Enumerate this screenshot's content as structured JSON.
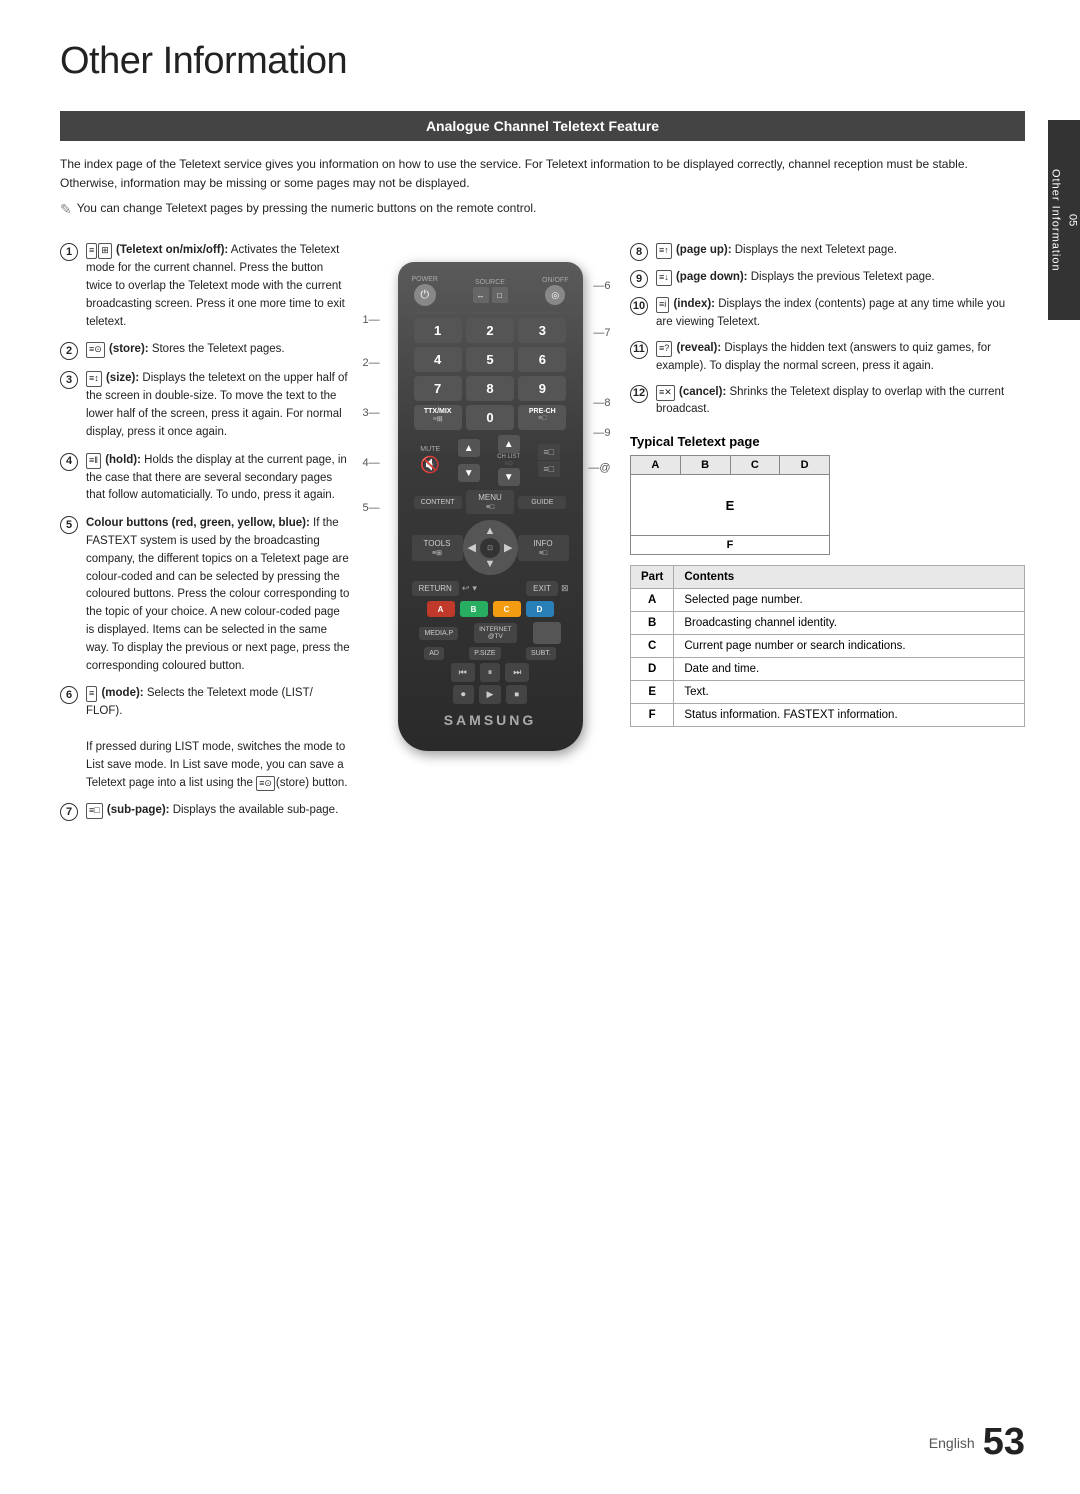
{
  "page": {
    "title": "Other Information",
    "side_tab": "Other Information",
    "side_tab_num": "05",
    "footer_english": "English",
    "footer_num": "53"
  },
  "section": {
    "header": "Analogue Channel Teletext Feature",
    "intro": "The index page of the Teletext service gives you information on how to use the service. For Teletext information to be displayed correctly, channel reception must be stable. Otherwise, information may be missing or some pages may not be displayed.",
    "note": "You can change Teletext pages by pressing the numeric buttons on the remote control."
  },
  "left_bullets": [
    {
      "num": "1",
      "text": "(Teletext on/mix/off): Activates the Teletext mode for the current channel. Press the button twice to overlap the Teletext mode with the current broadcasting screen. Press it one more time to exit teletext."
    },
    {
      "num": "2",
      "text": "(store): Stores the Teletext pages."
    },
    {
      "num": "3",
      "text": "(size): Displays the teletext on the upper half of the screen in double-size. To move the text to the lower half of the screen, press it again. For normal display, press it once again."
    },
    {
      "num": "4",
      "text": "(hold): Holds the display at the current page, in the case that there are several secondary pages that follow automaticially. To undo, press it again."
    },
    {
      "num": "5",
      "text": "Colour buttons (red, green, yellow, blue): If the FASTEXT system is used by the broadcasting company, the different topics on a Teletext page are colour-coded and can be selected by pressing the coloured buttons. Press the colour corresponding to the topic of your choice. A new colour-coded page is displayed. Items can be selected in the same way. To display the previous or next page, press the corresponding coloured button."
    },
    {
      "num": "6",
      "text": "(mode): Selects the Teletext mode (LIST/ FLOF).\n\nIf pressed during LIST mode, switches the mode to List save mode. In List save mode, you can save a Teletext page into a list using the (store) button."
    },
    {
      "num": "7",
      "text": "(sub-page): Displays the available sub-page."
    }
  ],
  "right_bullets": [
    {
      "num": "8",
      "text": "(page up): Displays the next Teletext page."
    },
    {
      "num": "9",
      "text": "(page down): Displays the previous Teletext page."
    },
    {
      "num": "10",
      "text": "(index): Displays the index (contents) page at any time while you are viewing Teletext."
    },
    {
      "num": "11",
      "text": "(reveal): Displays the hidden text (answers to quiz games, for example). To display the normal screen, press it again."
    },
    {
      "num": "12",
      "text": "(cancel): Shrinks the Teletext display to overlap with the current broadcast."
    }
  ],
  "teletext_page": {
    "title": "Typical Teletext page",
    "cells": [
      "A",
      "B",
      "C",
      "D"
    ],
    "body_label": "E",
    "footer_label": "F"
  },
  "parts_table": {
    "headers": [
      "Part",
      "Contents"
    ],
    "rows": [
      {
        "part": "A",
        "contents": "Selected page number."
      },
      {
        "part": "B",
        "contents": "Broadcasting channel identity."
      },
      {
        "part": "C",
        "contents": "Current page number or search indications."
      },
      {
        "part": "D",
        "contents": "Date and time."
      },
      {
        "part": "E",
        "contents": "Text."
      },
      {
        "part": "F",
        "contents": "Status information. FASTEXT information."
      }
    ]
  },
  "remote": {
    "brand": "SAMSUNG",
    "buttons": {
      "power": "⏻",
      "source": "SOURCE",
      "onoff": "ON/OFF",
      "nums": [
        "1",
        "2",
        "3",
        "4",
        "5",
        "6",
        "7",
        "8",
        "9",
        "TTX/MIX",
        "0",
        "PRE-CH"
      ],
      "mute": "🔇",
      "vol_up": "▲",
      "vol_down": "▼",
      "ch_up": "▲",
      "ch_down": "▼",
      "ch_list": "CH LIST",
      "content": "CONTENT",
      "menu": "MENU",
      "guide": "GUIDE",
      "tools": "TOOLS",
      "info": "INFO",
      "return": "RETURN",
      "exit": "EXIT",
      "colors": [
        "A",
        "B",
        "C",
        "D"
      ],
      "media_p": "MEDIA.P",
      "internet": "INTERNET @TV",
      "ad": "AD",
      "p_size": "P.SIZE",
      "subt": "SUBT."
    }
  }
}
